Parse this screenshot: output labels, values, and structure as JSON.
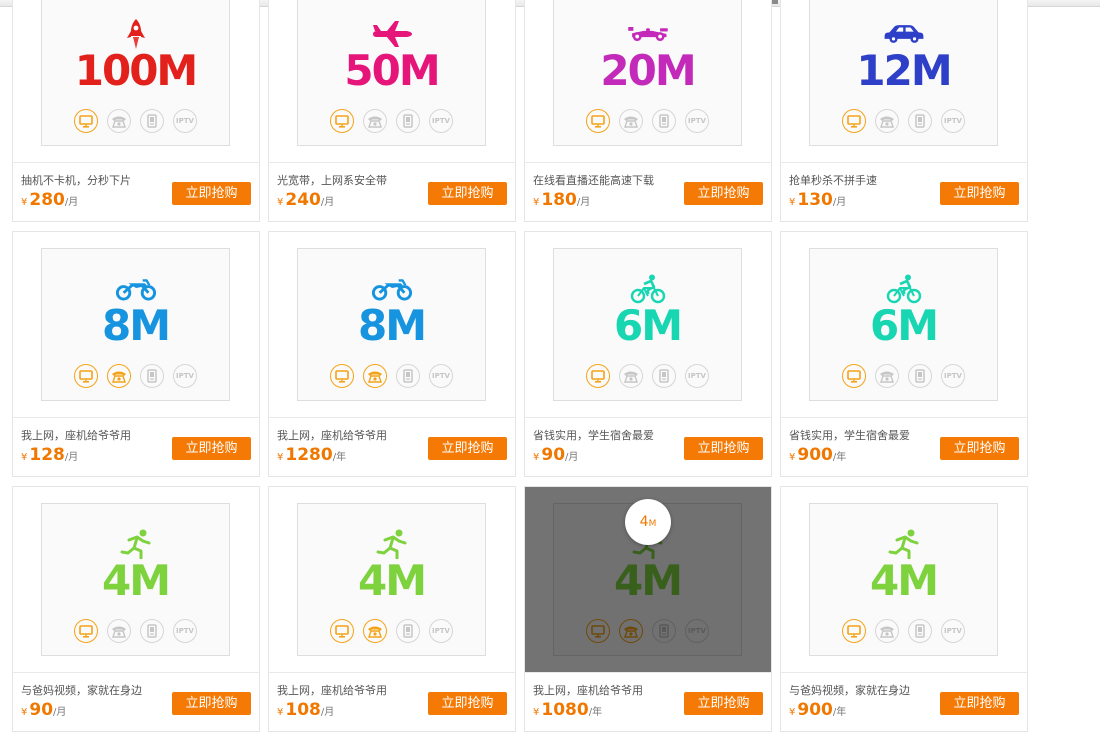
{
  "button_label": "立即抢购",
  "currency_symbol": "¥",
  "service_labels": {
    "iptv": "IPTV"
  },
  "accent_color": "#f57a05",
  "price_color": "#f07800",
  "service_active_color": "#f4a316",
  "plans": [
    {
      "speed": "100M",
      "color": "#e3211c",
      "icon": "rocket-icon",
      "desc": "抽机不卡机，分秒下片",
      "price": "280",
      "unit": "/月",
      "services": {
        "tv": true,
        "phone": false,
        "mobile": false,
        "iptv": false
      }
    },
    {
      "speed": "50M",
      "color": "#e5157a",
      "icon": "airplane-icon",
      "desc": "光宽带，上网系安全带",
      "price": "240",
      "unit": "/月",
      "services": {
        "tv": true,
        "phone": false,
        "mobile": false,
        "iptv": false
      }
    },
    {
      "speed": "20M",
      "color": "#c32ab9",
      "icon": "race-car-icon",
      "desc": "在线看直播还能高速下载",
      "price": "180",
      "unit": "/月",
      "services": {
        "tv": true,
        "phone": false,
        "mobile": false,
        "iptv": false
      }
    },
    {
      "speed": "12M",
      "color": "#2f40c8",
      "icon": "car-icon",
      "desc": "抢单秒杀不拼手速",
      "price": "130",
      "unit": "/月",
      "services": {
        "tv": true,
        "phone": false,
        "mobile": false,
        "iptv": false
      }
    },
    {
      "speed": "8M",
      "color": "#1694e0",
      "icon": "motorcycle-icon",
      "desc": "我上网，座机给爷爷用",
      "price": "128",
      "unit": "/月",
      "services": {
        "tv": true,
        "phone": true,
        "mobile": false,
        "iptv": false
      }
    },
    {
      "speed": "8M",
      "color": "#1694e0",
      "icon": "motorcycle-icon",
      "desc": "我上网，座机给爷爷用",
      "price": "1280",
      "unit": "/年",
      "services": {
        "tv": true,
        "phone": true,
        "mobile": false,
        "iptv": false
      }
    },
    {
      "speed": "6M",
      "color": "#19d6b3",
      "icon": "bicycle-icon",
      "desc": "省钱实用，学生宿舍最爱",
      "price": "90",
      "unit": "/月",
      "services": {
        "tv": true,
        "phone": false,
        "mobile": false,
        "iptv": false
      }
    },
    {
      "speed": "6M",
      "color": "#19d6b3",
      "icon": "bicycle-icon",
      "desc": "省钱实用，学生宿舍最爱",
      "price": "900",
      "unit": "/年",
      "services": {
        "tv": true,
        "phone": false,
        "mobile": false,
        "iptv": false
      }
    },
    {
      "speed": "4M",
      "color": "#7ed23e",
      "icon": "runner-icon",
      "desc": "与爸妈视频，家就在身边",
      "price": "90",
      "unit": "/月",
      "services": {
        "tv": true,
        "phone": false,
        "mobile": false,
        "iptv": false
      }
    },
    {
      "speed": "4M",
      "color": "#7ed23e",
      "icon": "runner-icon",
      "desc": "我上网，座机给爷爷用",
      "price": "108",
      "unit": "/月",
      "services": {
        "tv": true,
        "phone": true,
        "mobile": false,
        "iptv": false
      }
    },
    {
      "speed": "4M",
      "color": "#7ed23e",
      "icon": "runner-icon",
      "desc": "我上网，座机给爷爷用",
      "price": "1080",
      "unit": "/年",
      "services": {
        "tv": true,
        "phone": true,
        "mobile": false,
        "iptv": false
      },
      "hover": true,
      "bubble_number": "4",
      "bubble_unit": "M"
    },
    {
      "speed": "4M",
      "color": "#7ed23e",
      "icon": "runner-icon",
      "desc": "与爸妈视频，家就在身边",
      "price": "900",
      "unit": "/年",
      "services": {
        "tv": true,
        "phone": false,
        "mobile": false,
        "iptv": false
      }
    }
  ]
}
